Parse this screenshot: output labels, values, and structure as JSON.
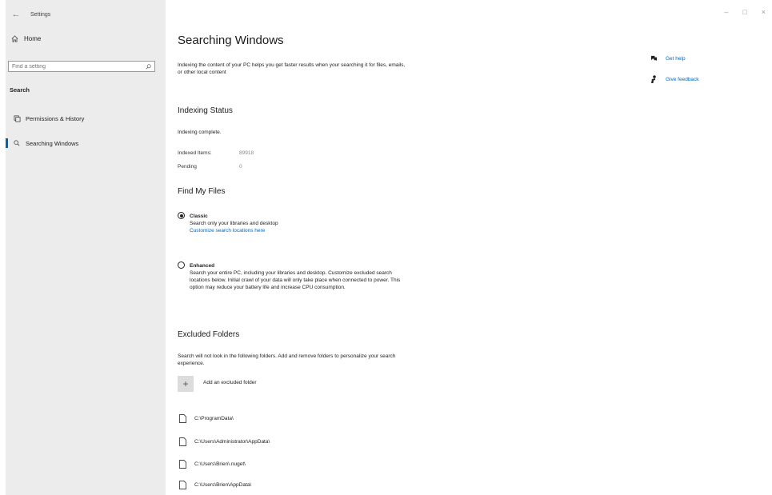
{
  "window": {
    "title": "Settings",
    "back_glyph": "←",
    "minimize_glyph": "–",
    "maximize_glyph": "□",
    "close_glyph": "×"
  },
  "sidebar": {
    "home_label": "Home",
    "search_placeholder": "Find a setting",
    "section_label": "Search",
    "items": [
      {
        "label": "Permissions & History",
        "icon": "history-icon"
      },
      {
        "label": "Searching Windows",
        "icon": "search-icon",
        "selected": true
      }
    ]
  },
  "main": {
    "title": "Searching Windows",
    "intro": "Indexing the content of your PC helps you get faster results when your searching it for files, emails, or other local content",
    "indexing_status": {
      "heading": "Indexing Status",
      "status_text": "Indexing complete.",
      "indexed_items_label": "Indexed Items:",
      "indexed_items_value": "89918",
      "pending_label": "Pending",
      "pending_value": "0"
    },
    "find_my_files": {
      "heading": "Find My Files",
      "options": [
        {
          "title": "Classic",
          "description": "Search only your libraries and desktop",
          "link": "Customize search locations here",
          "selected": true
        },
        {
          "title": "Enhanced",
          "description": "Search your entire PC, including your libraries and desktop. Customize excluded search locations below. Initial crawl of your data will only take place when connected to power. This option may reduce your battery life and increase CPU consumption.",
          "selected": false
        }
      ]
    },
    "excluded_folders": {
      "heading": "Excluded Folders",
      "description": "Search will not look in the following folders. Add and remove folders to personalize your search experience.",
      "add_label": "Add an excluded folder",
      "folders": [
        "C:\\ProgramData\\",
        "C:\\Users\\Administrator\\AppData\\",
        "C:\\Users\\Brien\\.nuget\\",
        "C:\\Users\\Brien\\AppData\\"
      ]
    }
  },
  "help": {
    "get_help": "Get help",
    "give_feedback": "Give feedback"
  },
  "colors": {
    "accent": "#0067c0",
    "sidebar_bg": "#ececec",
    "selection_bar": "#0063b1"
  }
}
